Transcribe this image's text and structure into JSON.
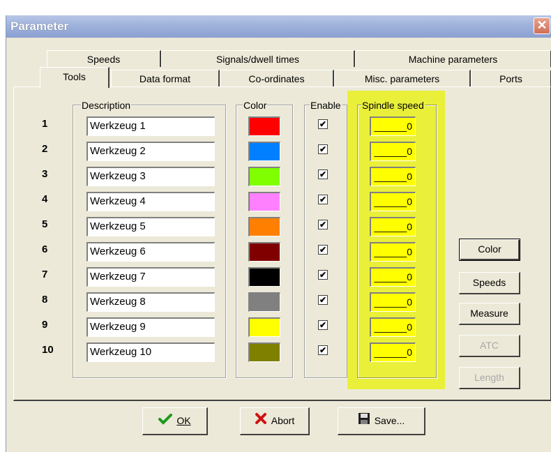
{
  "window": {
    "title": "Parameter",
    "close_glyph": "✕"
  },
  "tabs_back": [
    {
      "label": "Speeds"
    },
    {
      "label": "Signals/dwell times"
    },
    {
      "label": "Machine parameters"
    }
  ],
  "tabs_front": [
    {
      "label": "Tools",
      "active": true
    },
    {
      "label": "Data format"
    },
    {
      "label": "Co-ordinates"
    },
    {
      "label": "Misc. parameters"
    },
    {
      "label": "Ports"
    }
  ],
  "groups": {
    "description": "Description",
    "color": "Color",
    "enable": "Enable",
    "spindle": "Spindle speed"
  },
  "tools": [
    {
      "num": "1",
      "desc": "Werkzeug 1",
      "color": "#ff0000",
      "enabled": "✔",
      "speed": "______0"
    },
    {
      "num": "2",
      "desc": "Werkzeug 2",
      "color": "#0080ff",
      "enabled": "✔",
      "speed": "______0"
    },
    {
      "num": "3",
      "desc": "Werkzeug 3",
      "color": "#80ff00",
      "enabled": "✔",
      "speed": "______0"
    },
    {
      "num": "4",
      "desc": "Werkzeug 4",
      "color": "#ff80ff",
      "enabled": "✔",
      "speed": "______0"
    },
    {
      "num": "5",
      "desc": "Werkzeug 5",
      "color": "#ff8000",
      "enabled": "✔",
      "speed": "______0"
    },
    {
      "num": "6",
      "desc": "Werkzeug 6",
      "color": "#800000",
      "enabled": "✔",
      "speed": "______0"
    },
    {
      "num": "7",
      "desc": "Werkzeug 7",
      "color": "#000000",
      "enabled": "✔",
      "speed": "______0"
    },
    {
      "num": "8",
      "desc": "Werkzeug 8",
      "color": "#808080",
      "enabled": "✔",
      "speed": "______0"
    },
    {
      "num": "9",
      "desc": "Werkzeug 9",
      "color": "#ffff00",
      "enabled": "✔",
      "speed": "______0"
    },
    {
      "num": "10",
      "desc": "Werkzeug 10",
      "color": "#808000",
      "enabled": "✔",
      "speed": "______0"
    }
  ],
  "side_buttons": {
    "color": "Color",
    "speeds": "Speeds",
    "measure": "Measure",
    "atc": "ATC",
    "length": "Length"
  },
  "bottom_buttons": {
    "ok": "OK",
    "abort": "Abort",
    "save": "Save..."
  },
  "colors": {
    "highlight": "#ffff00",
    "spindle_highlight_bg": "#eaf03a"
  }
}
